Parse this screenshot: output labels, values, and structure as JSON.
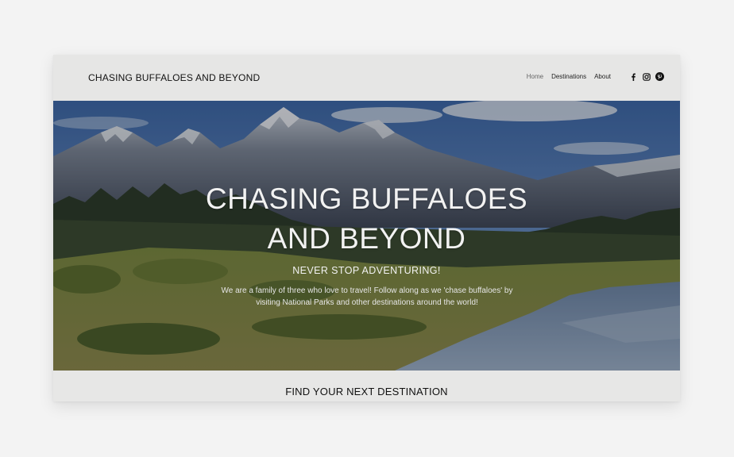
{
  "header": {
    "site_title": "CHASING BUFFALOES AND BEYOND",
    "nav": [
      {
        "label": "Home"
      },
      {
        "label": "Destinations"
      },
      {
        "label": "About"
      }
    ],
    "social_icons": [
      "facebook-icon",
      "instagram-icon",
      "pinterest-icon"
    ]
  },
  "hero": {
    "title_line1": "CHASING BUFFALOES",
    "title_line2": "AND BEYOND",
    "subtitle": "NEVER STOP ADVENTURING!",
    "description": "We are a family of three who love to travel! Follow along as we 'chase buffaloes' by visiting National Parks and other destinations around the world!"
  },
  "section": {
    "title": "FIND YOUR NEXT DESTINATION"
  },
  "colors": {
    "page_bg": "#f3f3f3",
    "header_bg": "#e6e6e5",
    "text": "#111111"
  }
}
